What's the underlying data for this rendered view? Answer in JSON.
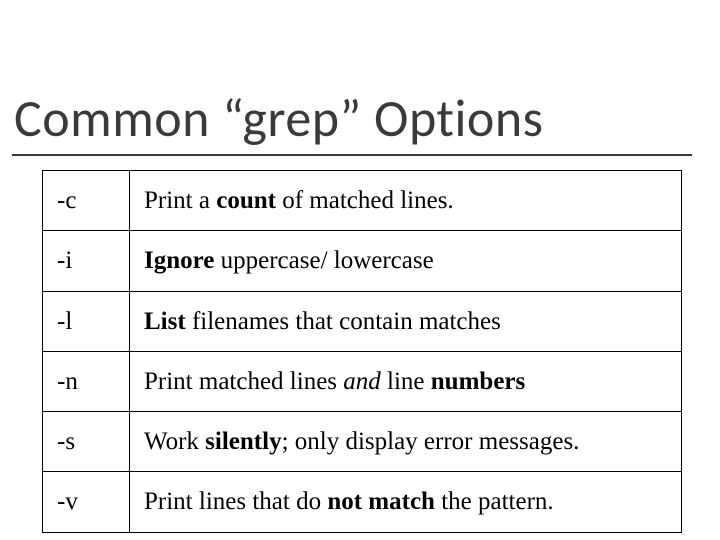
{
  "title": "Common “grep” Options",
  "rows": [
    {
      "flag": "-c",
      "desc_pre": "Print a ",
      "bold": "count",
      "desc_post": " of matched lines."
    },
    {
      "flag": "-i",
      "bold": "Ignore",
      "desc_post": " uppercase/ lowercase"
    },
    {
      "flag": "-l",
      "bold": "List",
      "desc_post": " filenames that contain matches"
    },
    {
      "flag": "-n",
      "desc_pre": "Print matched lines ",
      "italic": "and",
      "desc_post2": " line ",
      "bold": "numbers"
    },
    {
      "flag": "-s",
      "desc_pre": "Work ",
      "bold": "silently",
      "desc_post": "; only display error messages."
    },
    {
      "flag": "-v",
      "desc_pre": "Print lines that do ",
      "bold": "not match",
      "desc_post": " the pattern."
    }
  ]
}
